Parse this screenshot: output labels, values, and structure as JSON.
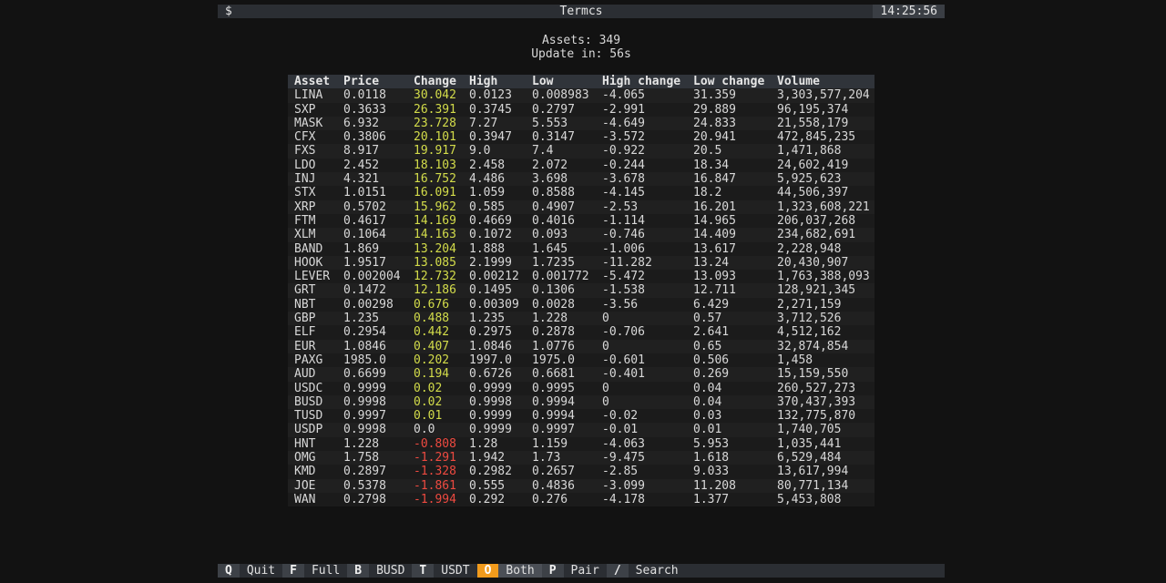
{
  "header": {
    "prompt": "$",
    "title": "Termcs",
    "time": "14:25:56"
  },
  "summary": {
    "assets": "Assets: 349",
    "update": "Update in: 56s"
  },
  "table": {
    "columns": [
      "Asset",
      "Price",
      "Change",
      "High",
      "Low",
      "High change",
      "Low change",
      "Volume"
    ],
    "rows": [
      [
        "LINA",
        "0.0118",
        "30.042",
        "0.0123",
        "0.008983",
        "-4.065",
        "31.359",
        "3,303,577,204"
      ],
      [
        "SXP",
        "0.3633",
        "26.391",
        "0.3745",
        "0.2797",
        "-2.991",
        "29.889",
        "96,195,374"
      ],
      [
        "MASK",
        "6.932",
        "23.728",
        "7.27",
        "5.553",
        "-4.649",
        "24.833",
        "21,558,179"
      ],
      [
        "CFX",
        "0.3806",
        "20.101",
        "0.3947",
        "0.3147",
        "-3.572",
        "20.941",
        "472,845,235"
      ],
      [
        "FXS",
        "8.917",
        "19.917",
        "9.0",
        "7.4",
        "-0.922",
        "20.5",
        "1,471,868"
      ],
      [
        "LDO",
        "2.452",
        "18.103",
        "2.458",
        "2.072",
        "-0.244",
        "18.34",
        "24,602,419"
      ],
      [
        "INJ",
        "4.321",
        "16.752",
        "4.486",
        "3.698",
        "-3.678",
        "16.847",
        "5,925,623"
      ],
      [
        "STX",
        "1.0151",
        "16.091",
        "1.059",
        "0.8588",
        "-4.145",
        "18.2",
        "44,506,397"
      ],
      [
        "XRP",
        "0.5702",
        "15.962",
        "0.585",
        "0.4907",
        "-2.53",
        "16.201",
        "1,323,608,221"
      ],
      [
        "FTM",
        "0.4617",
        "14.169",
        "0.4669",
        "0.4016",
        "-1.114",
        "14.965",
        "206,037,268"
      ],
      [
        "XLM",
        "0.1064",
        "14.163",
        "0.1072",
        "0.093",
        "-0.746",
        "14.409",
        "234,682,691"
      ],
      [
        "BAND",
        "1.869",
        "13.204",
        "1.888",
        "1.645",
        "-1.006",
        "13.617",
        "2,228,948"
      ],
      [
        "HOOK",
        "1.9517",
        "13.085",
        "2.1999",
        "1.7235",
        "-11.282",
        "13.24",
        "20,430,907"
      ],
      [
        "LEVER",
        "0.002004",
        "12.732",
        "0.00212",
        "0.001772",
        "-5.472",
        "13.093",
        "1,763,388,093"
      ],
      [
        "GRT",
        "0.1472",
        "12.186",
        "0.1495",
        "0.1306",
        "-1.538",
        "12.711",
        "128,921,345"
      ],
      [
        "NBT",
        "0.00298",
        "0.676",
        "0.00309",
        "0.0028",
        "-3.56",
        "6.429",
        "2,271,159"
      ],
      [
        "GBP",
        "1.235",
        "0.488",
        "1.235",
        "1.228",
        "0",
        "0.57",
        "3,712,526"
      ],
      [
        "ELF",
        "0.2954",
        "0.442",
        "0.2975",
        "0.2878",
        "-0.706",
        "2.641",
        "4,512,162"
      ],
      [
        "EUR",
        "1.0846",
        "0.407",
        "1.0846",
        "1.0776",
        "0",
        "0.65",
        "32,874,854"
      ],
      [
        "PAXG",
        "1985.0",
        "0.202",
        "1997.0",
        "1975.0",
        "-0.601",
        "0.506",
        "1,458"
      ],
      [
        "AUD",
        "0.6699",
        "0.194",
        "0.6726",
        "0.6681",
        "-0.401",
        "0.269",
        "15,159,550"
      ],
      [
        "USDC",
        "0.9999",
        "0.02",
        "0.9999",
        "0.9995",
        "0",
        "0.04",
        "260,527,273"
      ],
      [
        "BUSD",
        "0.9998",
        "0.02",
        "0.9998",
        "0.9994",
        "0",
        "0.04",
        "370,437,393"
      ],
      [
        "TUSD",
        "0.9997",
        "0.01",
        "0.9999",
        "0.9994",
        "-0.02",
        "0.03",
        "132,775,870"
      ],
      [
        "USDP",
        "0.9998",
        "0.0",
        "0.9999",
        "0.9997",
        "-0.01",
        "0.01",
        "1,740,705"
      ],
      [
        "HNT",
        "1.228",
        "-0.808",
        "1.28",
        "1.159",
        "-4.063",
        "5.953",
        "1,035,441"
      ],
      [
        "OMG",
        "1.758",
        "-1.291",
        "1.942",
        "1.73",
        "-9.475",
        "1.618",
        "6,529,484"
      ],
      [
        "KMD",
        "0.2897",
        "-1.328",
        "0.2982",
        "0.2657",
        "-2.85",
        "9.033",
        "13,617,994"
      ],
      [
        "JOE",
        "0.5378",
        "-1.861",
        "0.555",
        "0.4836",
        "-3.099",
        "11.208",
        "80,771,134"
      ],
      [
        "WAN",
        "0.2798",
        "-1.994",
        "0.292",
        "0.276",
        "-4.178",
        "1.377",
        "5,453,808"
      ]
    ]
  },
  "footer": {
    "items": [
      {
        "key": "Q",
        "label": "Quit",
        "active": false
      },
      {
        "key": "F",
        "label": "Full",
        "active": false
      },
      {
        "key": "B",
        "label": "BUSD",
        "active": false
      },
      {
        "key": "T",
        "label": "USDT",
        "active": false
      },
      {
        "key": "O",
        "label": "Both",
        "active": true
      },
      {
        "key": "P",
        "label": "Pair",
        "active": false
      },
      {
        "key": "/",
        "label": "Search",
        "active": false
      }
    ]
  },
  "colors": {
    "positive": "#d3dc4a",
    "negative": "#ee4a40",
    "active_key": "#f29b1c"
  }
}
